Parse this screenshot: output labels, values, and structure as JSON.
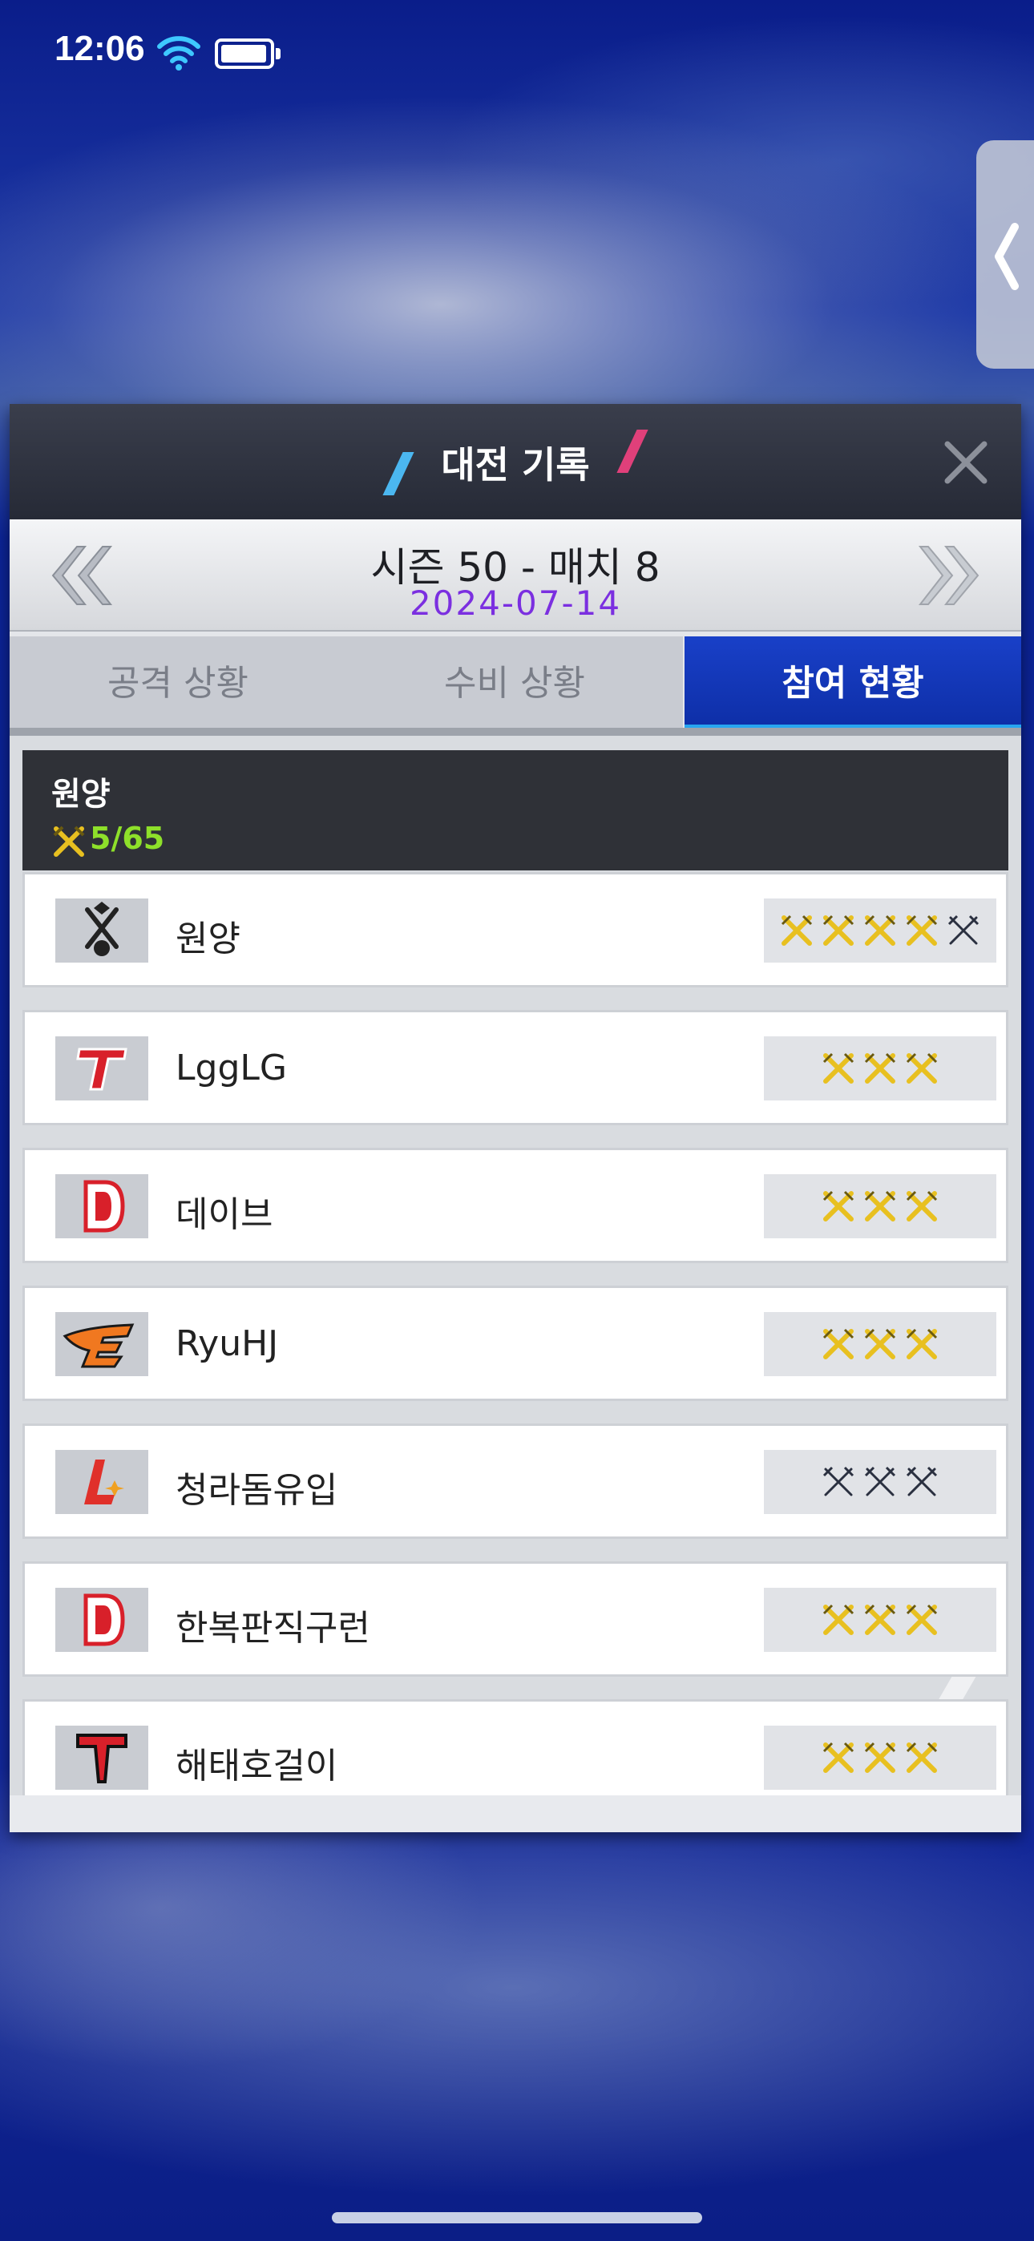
{
  "status_bar": {
    "time": "12:06"
  },
  "dialog": {
    "title": "대전 기록",
    "match_title": "시즌 50 - 매치 8",
    "match_date": "2024-07-14",
    "tabs": [
      {
        "label": "공격 상황",
        "active": false
      },
      {
        "label": "수비 상황",
        "active": false
      },
      {
        "label": "참여 현황",
        "active": true
      }
    ]
  },
  "team": {
    "name": "원양",
    "attack_count": "5/65"
  },
  "members": [
    {
      "name": "원양",
      "logo": "swords-emblem-logo",
      "used": 4,
      "total": 5
    },
    {
      "name": "LggLG",
      "logo": "red-t-logo",
      "used": 3,
      "total": 3
    },
    {
      "name": "데이브",
      "logo": "red-d-logo",
      "used": 3,
      "total": 3
    },
    {
      "name": "RyuHJ",
      "logo": "eagle-e-logo",
      "used": 3,
      "total": 3
    },
    {
      "name": "청라돔유입",
      "logo": "red-l-logo",
      "used": 0,
      "total": 3
    },
    {
      "name": "한복판직구런",
      "logo": "red-d-logo",
      "used": 3,
      "total": 3
    },
    {
      "name": "해태호걸이",
      "logo": "black-t-logo",
      "used": 3,
      "total": 3
    }
  ],
  "colors": {
    "active_tab": "#1940c8",
    "date": "#7b2fe0",
    "attack_count": "#8ee02a",
    "sword_used": "#e8c020",
    "sword_unused": "#2a3040"
  }
}
